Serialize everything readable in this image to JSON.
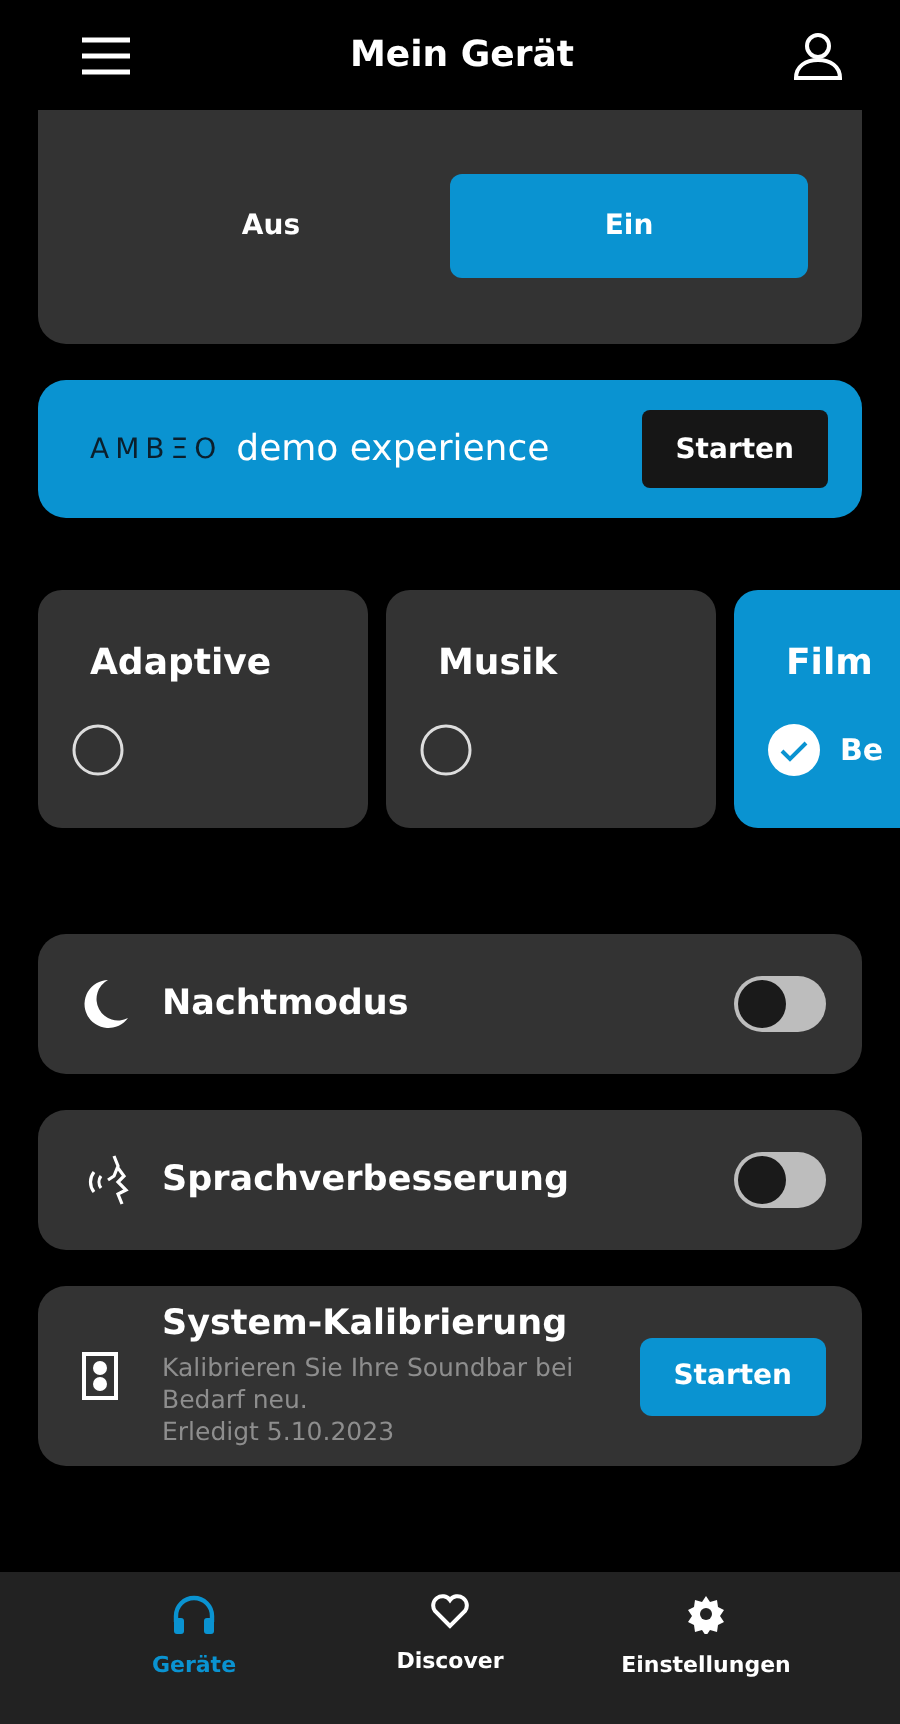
{
  "header": {
    "title": "Mein Gerät"
  },
  "segment": [
    {
      "label": "Aus",
      "selected": false
    },
    {
      "label": "Ein",
      "selected": true
    }
  ],
  "demo": {
    "logo": "AMBΞO",
    "title": "demo experience",
    "button": "Starten"
  },
  "modes": [
    {
      "label": "Adaptive",
      "selected": false
    },
    {
      "label": "Musik",
      "selected": false
    },
    {
      "label": "Film",
      "selected": true,
      "detail": "Be"
    }
  ],
  "settings": [
    {
      "kind": "toggle",
      "label": "Nachtmodus",
      "on": false
    },
    {
      "kind": "toggle",
      "label": "Sprachverbesserung",
      "on": false
    },
    {
      "kind": "action",
      "label": "System-Kalibrierung",
      "description": "Kalibrieren Sie Ihre Soundbar bei Bedarf neu.",
      "status": "Erledigt 5.10.2023",
      "button": "Starten"
    }
  ],
  "nav": [
    {
      "label": "Geräte",
      "selected": true
    },
    {
      "label": "Discover",
      "selected": false
    },
    {
      "label": "Einstellungen",
      "selected": false
    }
  ]
}
